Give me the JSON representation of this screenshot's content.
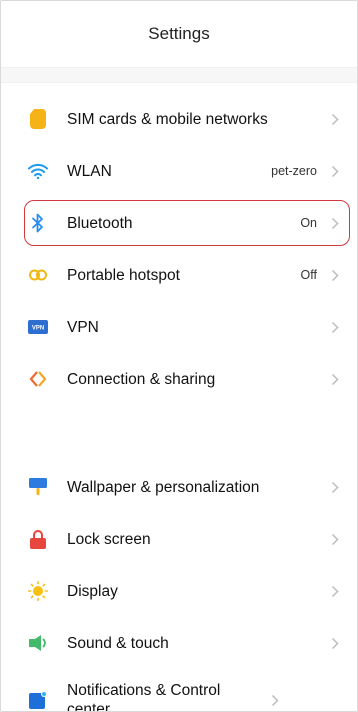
{
  "header": {
    "title": "Settings"
  },
  "colors": {
    "sim": "#f5b318",
    "wlan": "#1a9bf0",
    "bluetooth": "#2a8df2",
    "hotspot": "#f2b70f",
    "vpn": "#2c6fd1",
    "sharing": "#f06a2b",
    "wallpaper": "#2e7be0",
    "lock": "#e8453c",
    "display": "#f6c112",
    "sound": "#43b96a",
    "notifications": "#1f6fd9",
    "highlight": "#d0393f"
  },
  "network": [
    {
      "icon": "sim-card-icon",
      "label": "SIM cards & mobile networks",
      "value": ""
    },
    {
      "icon": "wifi-icon",
      "label": "WLAN",
      "value": "pet-zero"
    },
    {
      "icon": "bluetooth-icon",
      "label": "Bluetooth",
      "value": "On"
    },
    {
      "icon": "hotspot-icon",
      "label": "Portable hotspot",
      "value": "Off"
    },
    {
      "icon": "vpn-icon",
      "label": "VPN",
      "value": "",
      "badge": "VPN"
    },
    {
      "icon": "sharing-icon",
      "label": "Connection & sharing",
      "value": ""
    }
  ],
  "personal": [
    {
      "icon": "wallpaper-icon",
      "label": "Wallpaper & personalization"
    },
    {
      "icon": "lock-icon",
      "label": "Lock screen"
    },
    {
      "icon": "display-icon",
      "label": "Display"
    },
    {
      "icon": "speaker-icon",
      "label": "Sound & touch"
    },
    {
      "icon": "notifications-icon",
      "label": "Notifications & Control center"
    }
  ]
}
